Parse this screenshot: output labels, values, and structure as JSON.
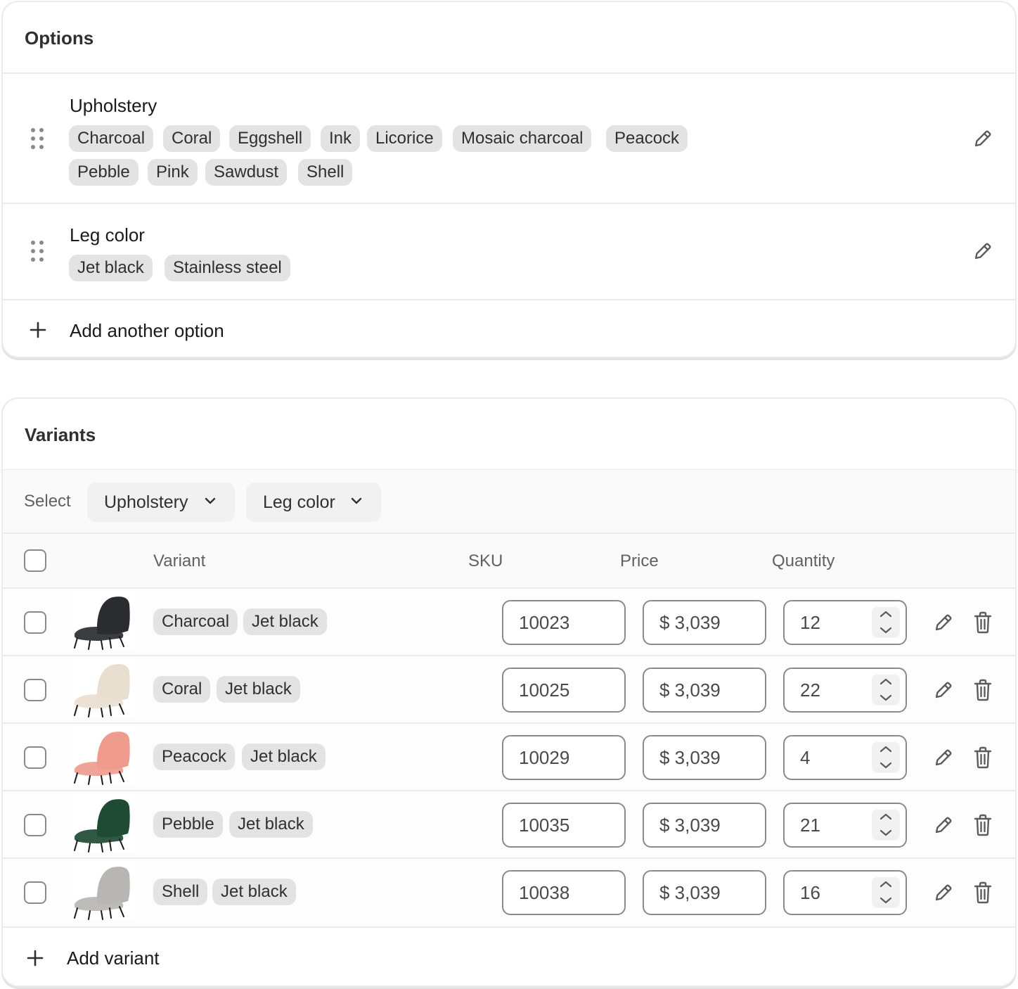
{
  "options": {
    "title": "Options",
    "items": [
      {
        "name": "Upholstery",
        "values": [
          "Charcoal",
          "Coral",
          "Eggshell",
          "Ink",
          "Licorice",
          "Mosaic charcoal",
          "Peacock",
          "Pebble",
          "Pink",
          "Sawdust",
          "Shell"
        ]
      },
      {
        "name": "Leg color",
        "values": [
          "Jet black",
          "Stainless steel"
        ]
      }
    ],
    "add_label": "Add another option"
  },
  "variants": {
    "title": "Variants",
    "select_label": "Select",
    "filters": [
      "Upholstery",
      "Leg color"
    ],
    "columns": {
      "variant": "Variant",
      "sku": "SKU",
      "price": "Price",
      "quantity": "Quantity"
    },
    "rows": [
      {
        "upholstery": "Charcoal",
        "leg": "Jet black",
        "sku": "10023",
        "price": "$ 3,039",
        "quantity": "12",
        "seat_color": "#2a2c30"
      },
      {
        "upholstery": "Coral",
        "leg": "Jet black",
        "sku": "10025",
        "price": "$ 3,039",
        "quantity": "22",
        "seat_color": "#e9dfd1"
      },
      {
        "upholstery": "Peacock",
        "leg": "Jet black",
        "sku": "10029",
        "price": "$ 3,039",
        "quantity": "4",
        "seat_color": "#ef9c8e"
      },
      {
        "upholstery": "Pebble",
        "leg": "Jet black",
        "sku": "10035",
        "price": "$ 3,039",
        "quantity": "21",
        "seat_color": "#1f4a33"
      },
      {
        "upholstery": "Shell",
        "leg": "Jet black",
        "sku": "10038",
        "price": "$ 3,039",
        "quantity": "16",
        "seat_color": "#b8b6b3"
      }
    ],
    "add_label": "Add variant"
  },
  "icons": {
    "drag": "drag-handle-icon",
    "edit": "pencil-icon",
    "delete": "trash-icon",
    "add": "plus-icon",
    "dropdown": "chevron-down-icon",
    "stepper": "chevron-up-down-icon"
  }
}
